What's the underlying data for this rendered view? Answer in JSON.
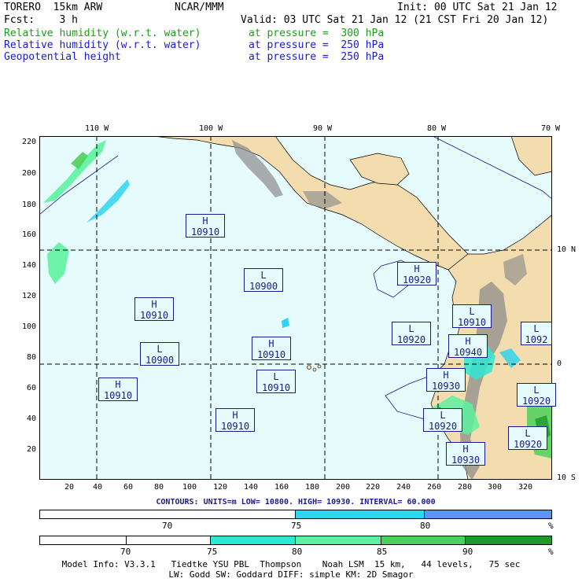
{
  "header": {
    "model": "TORERO  15km ARW",
    "org": "NCAR/MMM",
    "init": "Init: 00 UTC Sat 21 Jan 12",
    "fcst": "Fcst:    3 h",
    "valid": "Valid: 03 UTC Sat 21 Jan 12 (21 CST Fri 20 Jan 12)",
    "fields": [
      {
        "name": "Relative humidity (w.r.t. water)",
        "level": "at pressure =  300 hPa",
        "color": "#1a9e1a"
      },
      {
        "name": "Relative humidity (w.r.t. water)",
        "level": "at pressure =  250 hPa",
        "color": "#1a1ad0"
      },
      {
        "name": "Geopotential height",
        "level": "at pressure =  250 hPa",
        "color": "#1a1ad0"
      }
    ]
  },
  "map": {
    "lon_labels": [
      "110 W",
      "100 W",
      "90 W",
      "80 W",
      "70 W"
    ],
    "lat_labels": [
      "10 N",
      "0",
      "10 S"
    ],
    "y_ticks": [
      "220",
      "200",
      "180",
      "160",
      "140",
      "120",
      "100",
      "80",
      "60",
      "40",
      "20"
    ],
    "x_ticks": [
      "20",
      "40",
      "60",
      "80",
      "100",
      "120",
      "140",
      "160",
      "180",
      "200",
      "220",
      "240",
      "260",
      "280",
      "300",
      "320"
    ],
    "colors": {
      "ocean": "#e6fbfb",
      "land": "#f3dcae",
      "terrain": "#8c8c8c",
      "contour": "#1a1a90"
    },
    "centers": [
      {
        "type": "H",
        "value": "10910"
      },
      {
        "type": "L",
        "value": "10900"
      },
      {
        "type": "H",
        "value": "10910"
      },
      {
        "type": "L",
        "value": "10900"
      },
      {
        "type": "H",
        "value": "10910"
      },
      {
        "type": "H",
        "value": "10910"
      },
      {
        "type": "L",
        "value": "10910"
      },
      {
        "type": "H",
        "value": "10910"
      },
      {
        "type": "H",
        "value": "10920"
      },
      {
        "type": "L",
        "value": "10920"
      },
      {
        "type": "L",
        "value": "10910"
      },
      {
        "type": "H",
        "value": "10940"
      },
      {
        "type": "L",
        "value": "1092"
      },
      {
        "type": "H",
        "value": "10930"
      },
      {
        "type": "L",
        "value": "10920"
      },
      {
        "type": "L",
        "value": "10920"
      },
      {
        "type": "L",
        "value": "10920"
      },
      {
        "type": "H",
        "value": "10930"
      }
    ]
  },
  "contours_line": "CONTOURS:  UNITS=m  LOW=  10800.      HIGH=  10930.      INTERVAL=   60.000",
  "legend1": {
    "labels": [
      "70",
      "75",
      "80",
      "%"
    ],
    "colors": [
      "#ffffff",
      "#ffffff",
      "#2fd4ee",
      "#5c96f0"
    ]
  },
  "legend2": {
    "labels": [
      "70",
      "75",
      "80",
      "85",
      "90",
      "%"
    ],
    "colors": [
      "#ffffff",
      "#ffffff",
      "#2ee8d2",
      "#5cf2a0",
      "#4cd05a",
      "#1e9a2a"
    ]
  },
  "footer": {
    "line1": "Model Info: V3.3.1   Tiedtke YSU PBL  Thompson    Noah LSM  15 km,   44 levels,   75 sec",
    "line2": "LW: Godd SW: Goddard DIFF: simple KM: 2D Smagor"
  }
}
